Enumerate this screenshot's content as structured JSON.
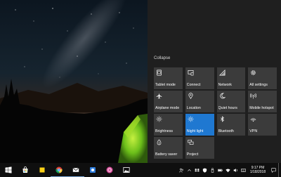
{
  "action_center": {
    "collapse_label": "Collapse",
    "tiles": [
      {
        "label": "Tablet mode",
        "icon": "tablet-mode-icon",
        "active": false
      },
      {
        "label": "Connect",
        "icon": "connect-icon",
        "active": false
      },
      {
        "label": "Network",
        "icon": "network-icon",
        "active": false
      },
      {
        "label": "All settings",
        "icon": "settings-icon",
        "active": false
      },
      {
        "label": "Airplane mode",
        "icon": "airplane-icon",
        "active": false
      },
      {
        "label": "Location",
        "icon": "location-icon",
        "active": false
      },
      {
        "label": "Quiet hours",
        "icon": "moon-icon",
        "active": false
      },
      {
        "label": "Mobile hotspot",
        "icon": "hotspot-icon",
        "active": false
      },
      {
        "label": "Brightness",
        "icon": "brightness-icon",
        "active": false
      },
      {
        "label": "Night light",
        "icon": "night-light-icon",
        "active": true
      },
      {
        "label": "Bluetooth",
        "icon": "bluetooth-icon",
        "active": false
      },
      {
        "label": "VPN",
        "icon": "vpn-icon",
        "active": false
      },
      {
        "label": "Battery saver",
        "icon": "battery-saver-icon",
        "active": false
      },
      {
        "label": "Project",
        "icon": "project-icon",
        "active": false
      }
    ]
  },
  "taskbar": {
    "apps": [
      {
        "icon": "start-icon"
      },
      {
        "icon": "store-icon"
      },
      {
        "icon": "sticky-notes-icon"
      },
      {
        "icon": "chrome-icon"
      },
      {
        "icon": "mail-icon"
      },
      {
        "icon": "app-icon"
      },
      {
        "icon": "skype-icon"
      },
      {
        "icon": "photos-icon"
      }
    ],
    "tray_icons": [
      "people-icon",
      "chevron-up-icon",
      "dropbox-icon",
      "security-icon",
      "usb-icon",
      "battery-icon",
      "wifi-icon",
      "volume-icon",
      "keyboard-icon"
    ],
    "clock": {
      "time": "9:17 PM",
      "date": "1/18/2018"
    },
    "notification_icon": "notification-icon"
  },
  "colors": {
    "accent": "#1f78d1",
    "tile": "#3b3b3b",
    "panel": "#1f1f1f",
    "taskbar": "#0f0f0f"
  }
}
